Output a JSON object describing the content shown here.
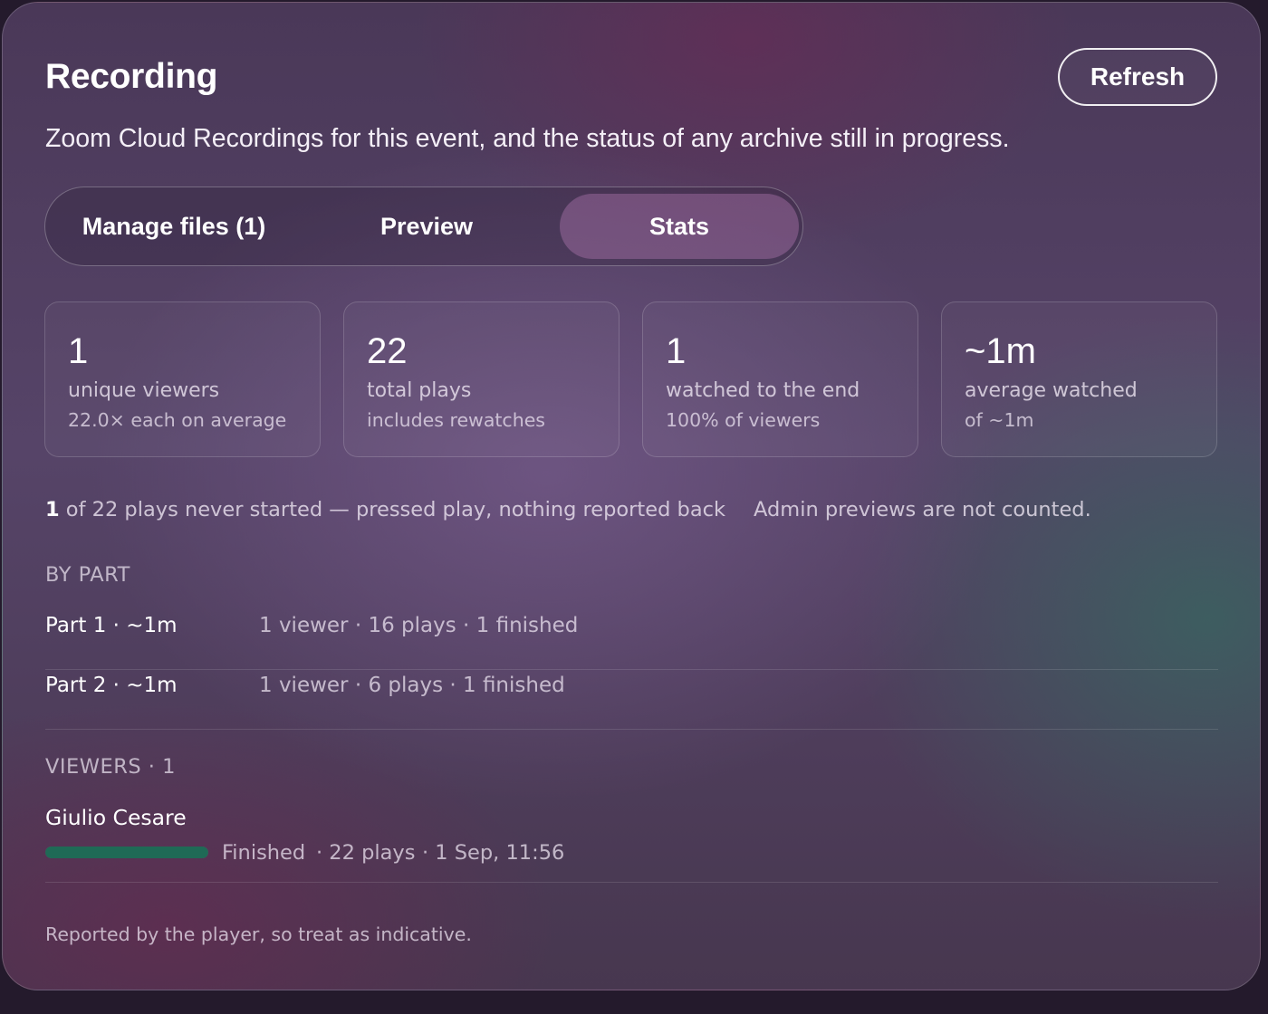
{
  "header": {
    "title": "Recording",
    "refresh_label": "Refresh",
    "subtitle": "Zoom Cloud Recordings for this event, and the status of any archive still in progress."
  },
  "tabs": [
    {
      "label": "Manage files (1)",
      "active": false
    },
    {
      "label": "Preview",
      "active": false
    },
    {
      "label": "Stats",
      "active": true
    }
  ],
  "stats": [
    {
      "value": "1",
      "label": "unique viewers",
      "note": "22.0× each on average"
    },
    {
      "value": "22",
      "label": "total plays",
      "note": "includes rewatches"
    },
    {
      "value": "1",
      "label": "watched to the end",
      "note": "100% of viewers"
    },
    {
      "value": "~1m",
      "label": "average watched",
      "note": "of ~1m"
    }
  ],
  "never_started": {
    "count": "1",
    "text": " of 22 plays never started — pressed play, nothing reported back"
  },
  "admin_note": "Admin previews are not counted.",
  "by_part": {
    "heading": "BY PART",
    "parts": [
      {
        "name": "Part 1 · ~1m",
        "info": "1 viewer · 16 plays · 1 finished"
      },
      {
        "name": "Part 2 · ~1m",
        "info": "1 viewer · 6 plays · 1 finished"
      }
    ]
  },
  "viewers": {
    "heading": "VIEWERS · 1",
    "list": [
      {
        "name": "Giulio Cesare",
        "progress": 1.0,
        "status": "Finished",
        "plays": "· 22 plays",
        "date": "· 1 Sep, 11:56"
      }
    ]
  },
  "footer": "Reported by the player, so treat as indicative.",
  "colors": {
    "progress_fill": "#1f6a56",
    "active_tab": "#9a6aa0"
  }
}
